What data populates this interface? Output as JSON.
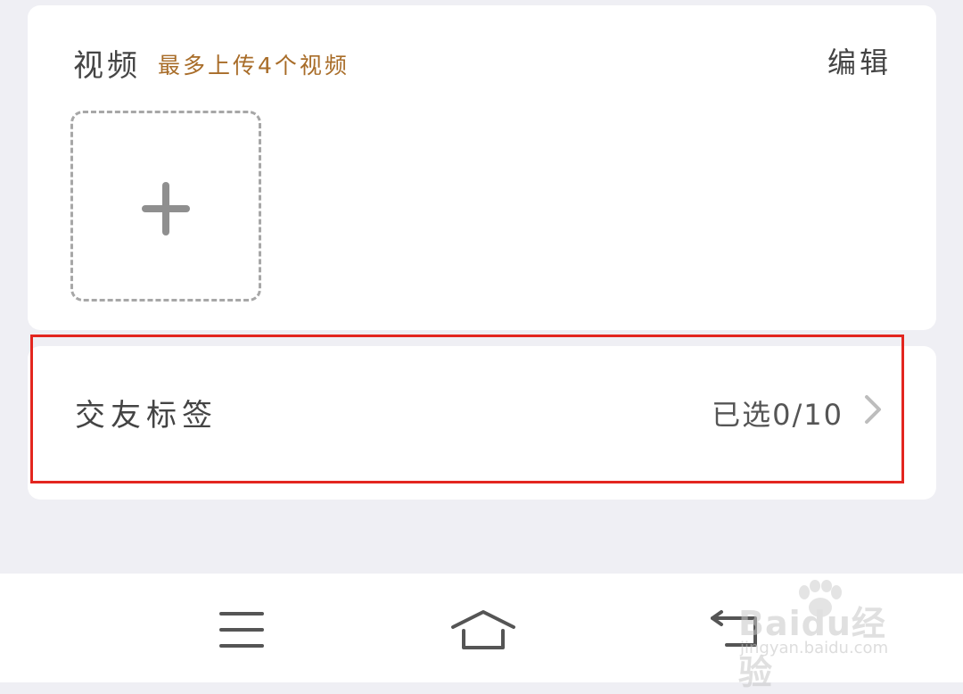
{
  "video_section": {
    "title": "视频",
    "hint": "最多上传4个视频",
    "edit_label": "编辑"
  },
  "tags_section": {
    "label": "交友标签",
    "value": "已选0/10"
  },
  "watermark": {
    "logo_text": "Baidu经验",
    "url_text": "jingyan.baidu.com"
  },
  "nav_bar": {
    "icons": [
      "menu-icon",
      "home-icon",
      "back-icon"
    ]
  },
  "colors": {
    "background": "#efeff4",
    "card": "#ffffff",
    "hint": "#a86c28",
    "highlight": "#e3261f",
    "text": "#444444"
  }
}
